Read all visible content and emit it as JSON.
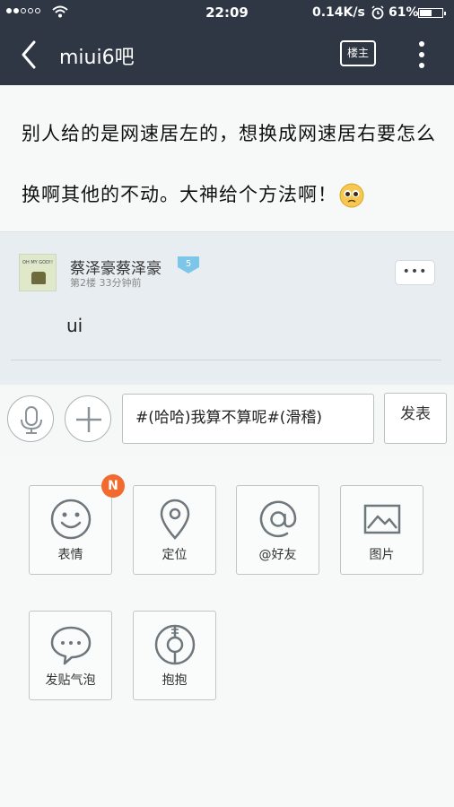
{
  "status_bar": {
    "time": "22:09",
    "network_speed": "0.14K/s",
    "battery_percent": "61%",
    "battery_level": 0.61
  },
  "nav": {
    "title": "miui6吧",
    "owner_button": "楼主",
    "icons": [
      "back-arrow-icon",
      "more-vertical-icon"
    ]
  },
  "post": {
    "text": "别人给的是网速居左的，想换成网速居右要怎么换啊其他的不动。大神给个方法啊！"
  },
  "reply": {
    "avatar_caption": "OH MY GOD!!",
    "username": "蔡泽豪蔡泽豪",
    "level": "5",
    "meta": "第2楼 33分钟前",
    "more": "•••",
    "content": "ui"
  },
  "input_bar": {
    "input_value": "#(哈哈)我算不算呢#(滑稽)",
    "publish_label": "发表"
  },
  "panel": {
    "badge": "N",
    "tiles": [
      {
        "label": "表情",
        "icon": "smiley-icon"
      },
      {
        "label": "定位",
        "icon": "location-pin-icon"
      },
      {
        "label": "@好友",
        "icon": "at-icon"
      },
      {
        "label": "图片",
        "icon": "image-icon"
      },
      {
        "label": "发贴气泡",
        "icon": "chat-bubble-icon"
      },
      {
        "label": "抱抱",
        "icon": "hug-icon"
      }
    ]
  },
  "colors": {
    "header_bg": "#2f3744",
    "reply_bg": "#e8edf1",
    "badge": "#f26a2e",
    "level_badge": "#7cc6ea"
  }
}
